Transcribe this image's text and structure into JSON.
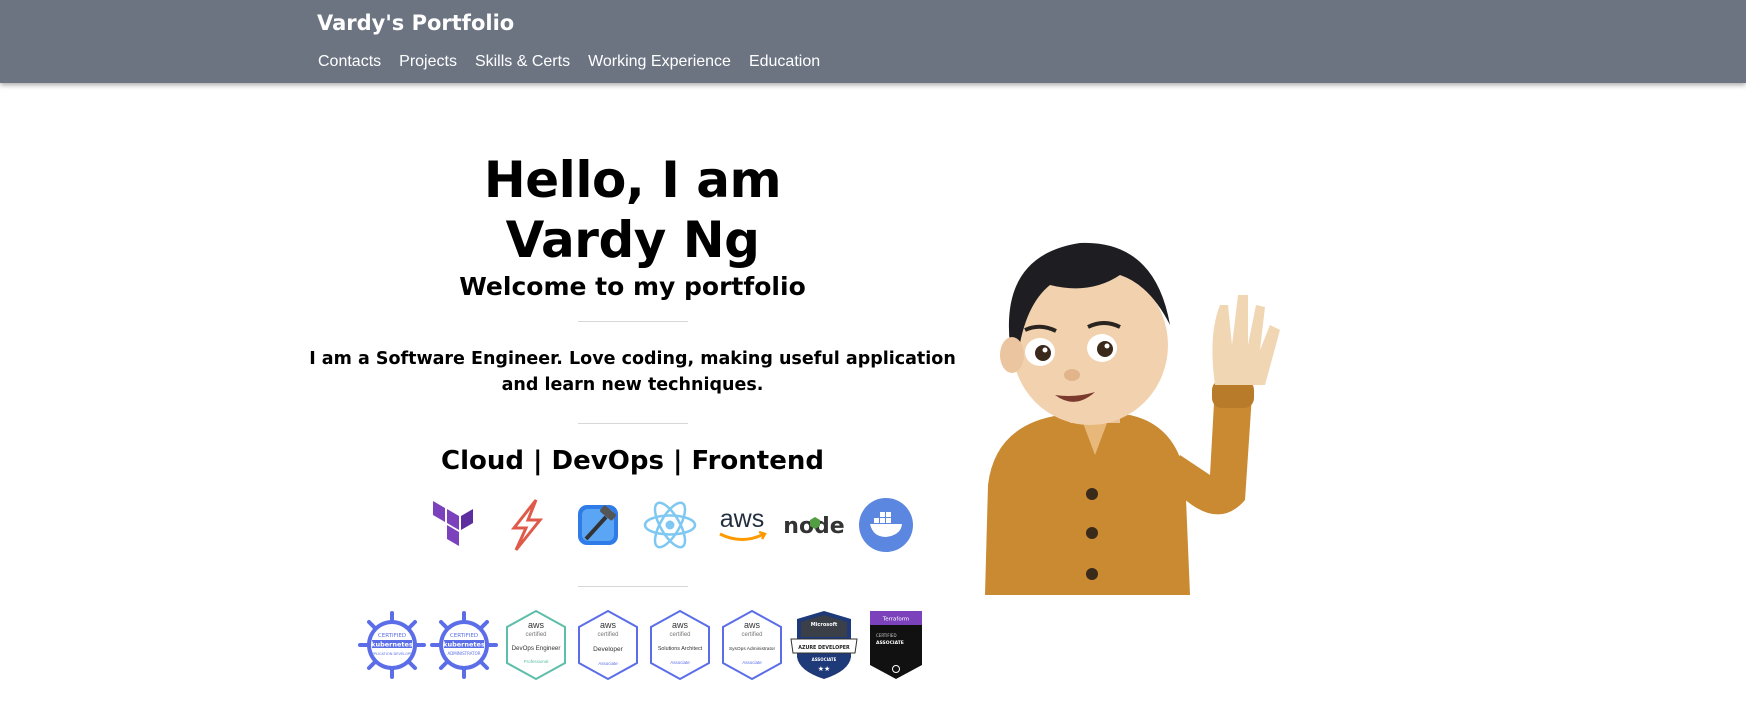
{
  "navbar": {
    "brand": "Vardy's Portfolio",
    "links": [
      "Contacts",
      "Projects",
      "Skills & Certs",
      "Working Experience",
      "Education"
    ]
  },
  "hero": {
    "title_line1": "Hello, I am",
    "title_line2": "Vardy Ng",
    "subtitle": "Welcome to my portfolio",
    "intro": "I am a Software Engineer. Love coding, making useful application and learn new techniques.",
    "stack": "Cloud | DevOps | Frontend"
  },
  "tech_icons": [
    {
      "icon": "terraform-icon",
      "color": "#7b42bc"
    },
    {
      "icon": "swift-icon",
      "color": "#f05138"
    },
    {
      "icon": "xcode-icon",
      "color": "#1c8df0"
    },
    {
      "icon": "react-icon",
      "color": "#61dafb"
    },
    {
      "icon": "aws-icon",
      "text": "aws",
      "color": "#ff9900"
    },
    {
      "icon": "nodejs-icon",
      "text": "node",
      "color": "#539e43"
    },
    {
      "icon": "docker-icon",
      "color": "#5c87e0"
    }
  ],
  "badges": [
    {
      "icon": "kubernetes-ckad-badge",
      "text1": "CERTIFIED",
      "text2": "kubernetes",
      "text3": "APPLICATION DEVELOPER",
      "color": "#5b6ee8"
    },
    {
      "icon": "kubernetes-cka-badge",
      "text1": "CERTIFIED",
      "text2": "kubernetes",
      "text3": "ADMINISTRATOR",
      "color": "#5b6ee8"
    },
    {
      "icon": "aws-devops-badge",
      "text1": "aws",
      "text2": "certified",
      "text3": "DevOps Engineer",
      "text4": "Professional",
      "color": "#5dbfa9"
    },
    {
      "icon": "aws-developer-badge",
      "text1": "aws",
      "text2": "certified",
      "text3": "Developer",
      "text4": "Associate",
      "color": "#5b6ee8"
    },
    {
      "icon": "aws-solutions-architect-badge",
      "text1": "aws",
      "text2": "certified",
      "text3": "Solutions Architect",
      "text4": "Associate",
      "color": "#5b6ee8"
    },
    {
      "icon": "aws-sysops-badge",
      "text1": "aws",
      "text2": "certified",
      "text3": "SysOps Administrator",
      "text4": "Associate",
      "color": "#5b6ee8"
    },
    {
      "icon": "azure-developer-badge",
      "text1": "Microsoft",
      "text2": "AZURE DEVELOPER",
      "text3": "ASSOCIATE",
      "color": "#1f3a78"
    },
    {
      "icon": "terraform-associate-badge",
      "text1": "Terraform",
      "text2": "CERTIFIED",
      "text3": "ASSOCIATE",
      "color": "#7b42bc"
    }
  ]
}
